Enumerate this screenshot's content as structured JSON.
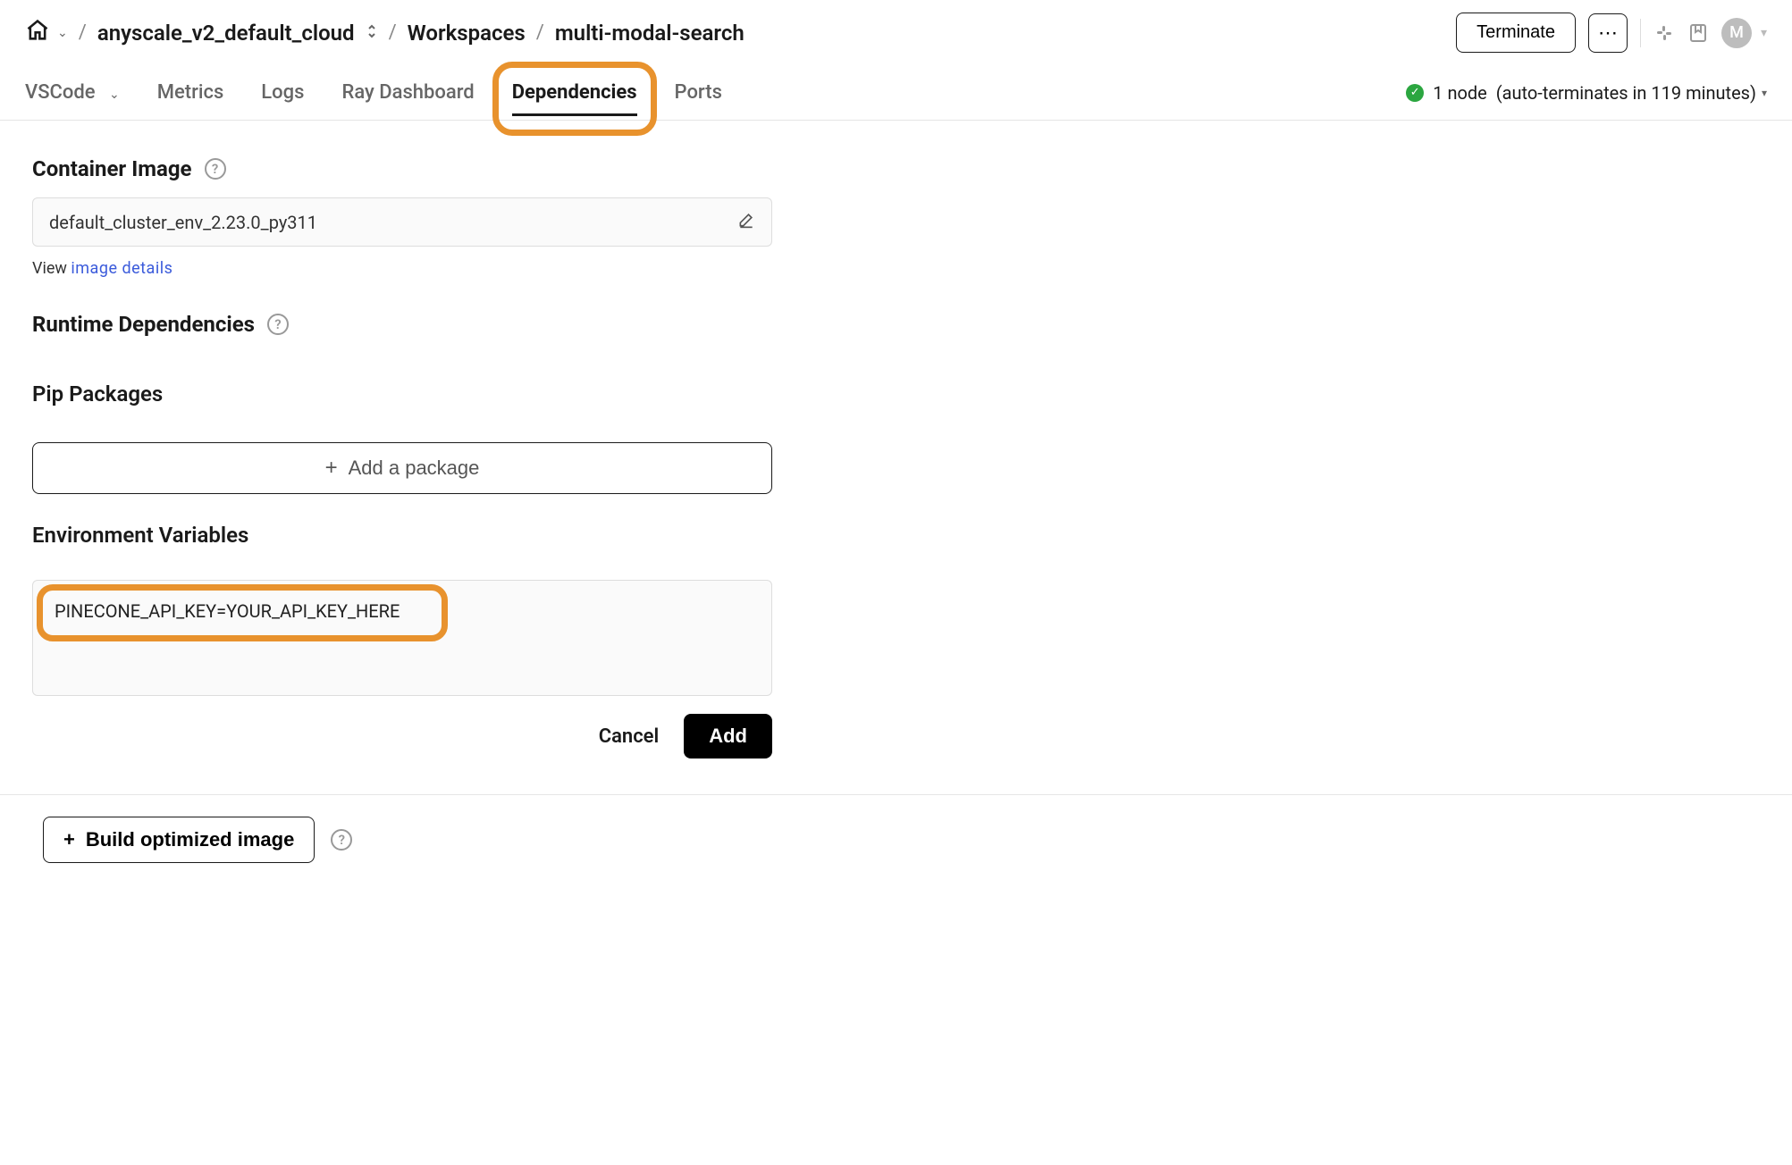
{
  "breadcrumb": {
    "cloud": "anyscale_v2_default_cloud",
    "workspaces": "Workspaces",
    "current": "multi-modal-search"
  },
  "header": {
    "terminate": "Terminate",
    "avatar_initial": "M"
  },
  "tabs": {
    "vscode": "VSCode",
    "metrics": "Metrics",
    "logs": "Logs",
    "ray_dashboard": "Ray Dashboard",
    "dependencies": "Dependencies",
    "ports": "Ports"
  },
  "status": {
    "nodes": "1 node",
    "auto_terminate": "(auto-terminates in 119 minutes)"
  },
  "sections": {
    "container_image": "Container Image",
    "runtime_dependencies": "Runtime Dependencies",
    "pip_packages": "Pip Packages",
    "env_vars": "Environment Variables"
  },
  "container": {
    "value": "default_cluster_env_2.23.0_py311",
    "view_label": "View",
    "view_link": "image details"
  },
  "pip": {
    "add_label": "Add a package"
  },
  "env": {
    "text": "PINECONE_API_KEY=YOUR_API_KEY_HERE"
  },
  "actions": {
    "cancel": "Cancel",
    "add": "Add"
  },
  "footer": {
    "build": "Build optimized image"
  }
}
